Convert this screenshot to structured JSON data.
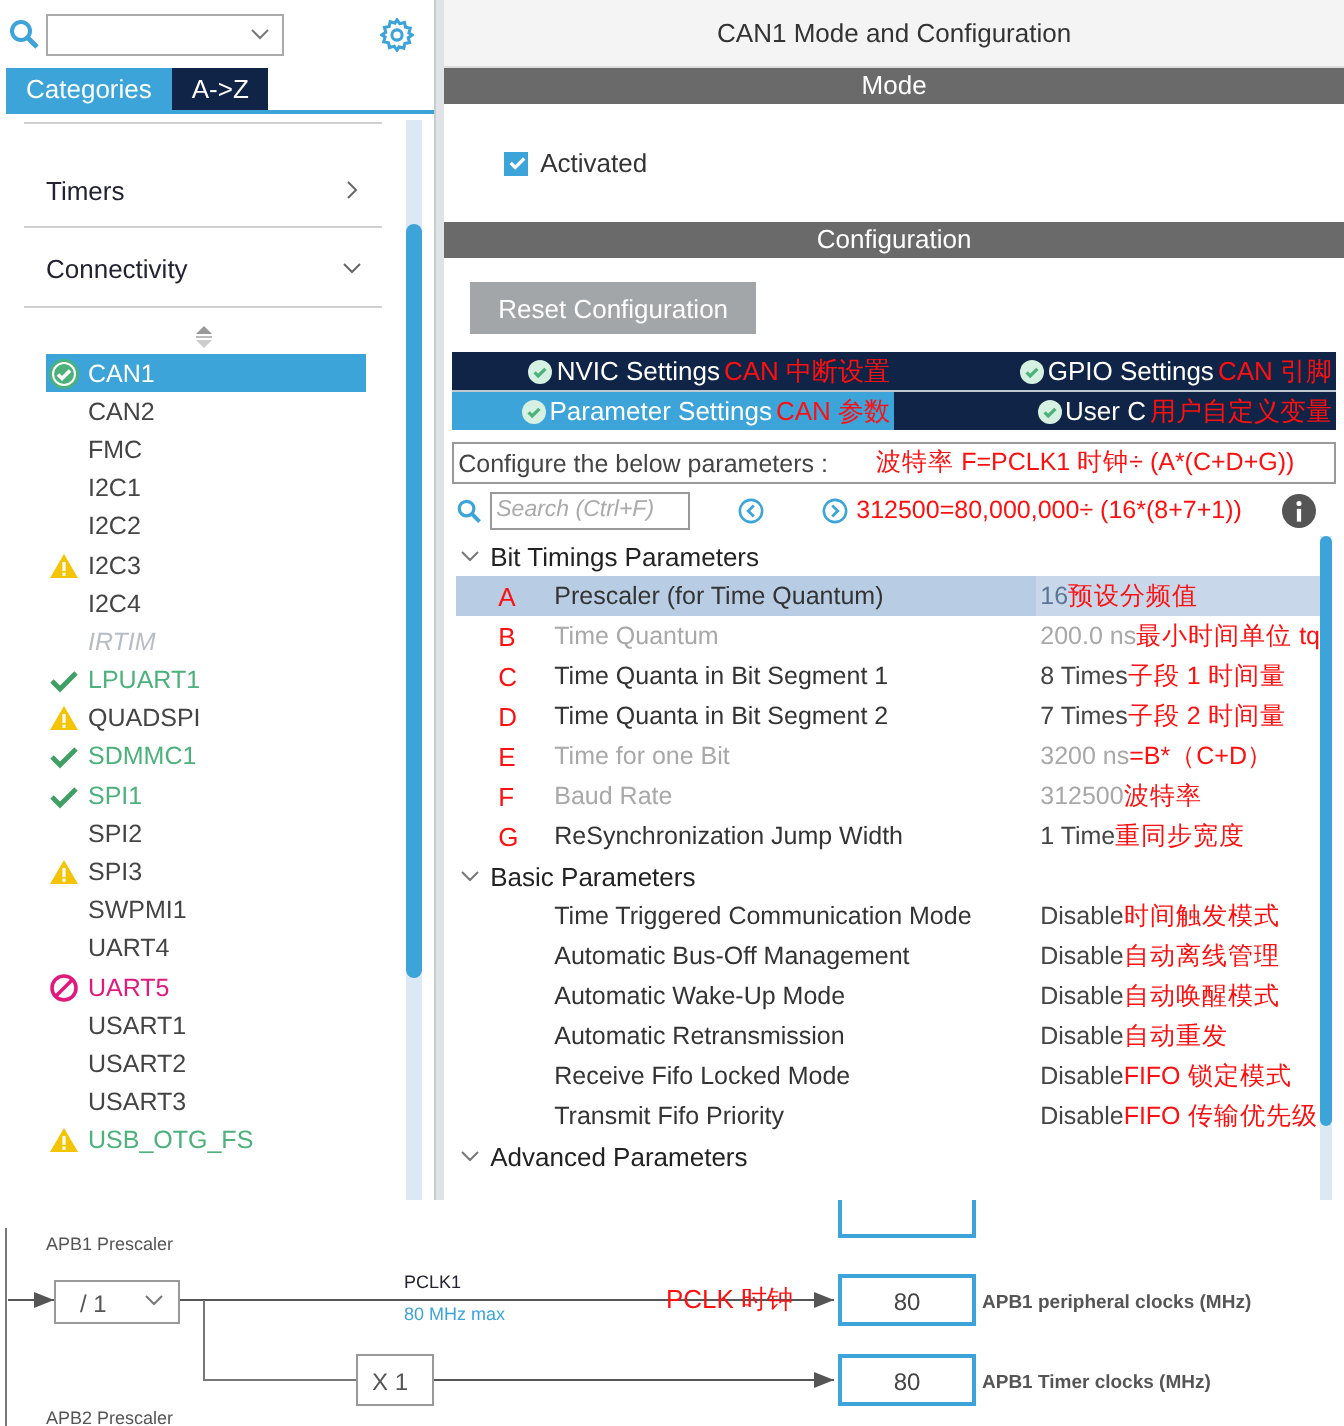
{
  "sidebar": {
    "tabs": [
      {
        "label": "Categories",
        "selected": true
      },
      {
        "label": "A->Z",
        "selected": false
      }
    ],
    "categories": [
      {
        "label": "Timers",
        "expanded": false
      },
      {
        "label": "Connectivity",
        "expanded": true,
        "children": [
          {
            "label": "CAN1",
            "kind": "active",
            "selected": true
          },
          {
            "label": "CAN2",
            "kind": "plain",
            "selected": false
          },
          {
            "label": "FMC",
            "kind": "plain",
            "selected": false
          },
          {
            "label": "I2C1",
            "kind": "plain",
            "selected": false
          },
          {
            "label": "I2C2",
            "kind": "plain",
            "selected": false
          },
          {
            "label": "I2C3",
            "kind": "warning",
            "selected": false
          },
          {
            "label": "I2C4",
            "kind": "plain",
            "selected": false
          },
          {
            "label": "IRTIM",
            "kind": "unavailable",
            "selected": false
          },
          {
            "label": "LPUART1",
            "kind": "configured",
            "selected": false
          },
          {
            "label": "QUADSPI",
            "kind": "warning",
            "selected": false
          },
          {
            "label": "SDMMC1",
            "kind": "configured",
            "selected": false
          },
          {
            "label": "SPI1",
            "kind": "configured",
            "selected": false
          },
          {
            "label": "SPI2",
            "kind": "plain",
            "selected": false
          },
          {
            "label": "SPI3",
            "kind": "warning",
            "selected": false
          },
          {
            "label": "SWPMI1",
            "kind": "plain",
            "selected": false
          },
          {
            "label": "UART4",
            "kind": "plain",
            "selected": false
          },
          {
            "label": "UART5",
            "kind": "conflict",
            "selected": false
          },
          {
            "label": "USART1",
            "kind": "plain",
            "selected": false
          },
          {
            "label": "USART2",
            "kind": "plain",
            "selected": false
          },
          {
            "label": "USART3",
            "kind": "plain",
            "selected": false
          },
          {
            "label": "USB_OTG_FS",
            "kind": "partial",
            "selected": false
          }
        ]
      }
    ]
  },
  "panel": {
    "title": "CAN1 Mode and Configuration",
    "mode": {
      "header": "Mode",
      "activated": {
        "label": "Activated",
        "checked": true
      }
    },
    "configuration": {
      "header": "Configuration",
      "reset_button": "Reset Configuration",
      "tabs": [
        {
          "label": "NVIC Settings",
          "note": "CAN 中断设置",
          "selected": false
        },
        {
          "label": "GPIO Settings",
          "note": "CAN 引脚",
          "selected": false
        },
        {
          "label": "Parameter Settings",
          "note": "CAN 参数",
          "selected": true
        },
        {
          "label": "User C",
          "note": "用户自定义变量",
          "selected": false
        }
      ],
      "hint": "Configure the below parameters :",
      "formula_notes": [
        "波特率 F=PCLK1 时钟÷ (A*(C+D+G))",
        "312500=80,000,000÷ (16*(8+7+1))"
      ],
      "search": {
        "placeholder": "Search (Ctrl+F)"
      },
      "groups": [
        {
          "label": "Bit Timings Parameters",
          "expanded": true,
          "children": [
            {
              "marker": "A",
              "name": "Prescaler (for Time Quantum)",
              "value": "16",
              "note": "预设分频值",
              "disabled": false,
              "selected": true
            },
            {
              "marker": "B",
              "name": "Time Quantum",
              "value": "200.0 ns",
              "note": "最小时间单位 tq",
              "disabled": true,
              "selected": false
            },
            {
              "marker": "C",
              "name": "Time Quanta in Bit Segment 1",
              "value": "8 Times",
              "note": "子段 1 时间量",
              "disabled": false,
              "selected": false
            },
            {
              "marker": "D",
              "name": "Time Quanta in Bit Segment 2",
              "value": "7 Times",
              "note": "子段 2 时间量",
              "disabled": false,
              "selected": false
            },
            {
              "marker": "E",
              "name": "Time for one Bit",
              "value": "3200 ns",
              "note": "=B*（C+D）",
              "disabled": true,
              "selected": false
            },
            {
              "marker": "F",
              "name": "Baud Rate",
              "value": "312500",
              "note": "波特率",
              "disabled": true,
              "selected": false
            },
            {
              "marker": "G",
              "name": "ReSynchronization Jump Width",
              "value": "1 Time",
              "note": "重同步宽度",
              "disabled": false,
              "selected": false
            }
          ]
        },
        {
          "label": "Basic Parameters",
          "expanded": true,
          "children": [
            {
              "name": "Time Triggered Communication Mode",
              "value": "Disable",
              "note": "时间触发模式",
              "disabled": false,
              "selected": false
            },
            {
              "name": "Automatic Bus-Off Management",
              "value": "Disable",
              "note": "自动离线管理",
              "disabled": false,
              "selected": false
            },
            {
              "name": "Automatic Wake-Up Mode",
              "value": "Disable",
              "note": "自动唤醒模式",
              "disabled": false,
              "selected": false
            },
            {
              "name": "Automatic Retransmission",
              "value": "Disable",
              "note": "自动重发",
              "disabled": false,
              "selected": false
            },
            {
              "name": "Receive Fifo Locked Mode",
              "value": "Disable",
              "note": "FIFO 锁定模式",
              "disabled": false,
              "selected": false
            },
            {
              "name": "Transmit Fifo Priority",
              "value": "Disable",
              "note": "FIFO 传输优先级",
              "disabled": false,
              "selected": false
            }
          ]
        },
        {
          "label": "Advanced Parameters",
          "expanded": true
        }
      ]
    }
  },
  "diagram": {
    "labels": [
      "APB1 Prescaler",
      "APB2 Prescaler"
    ],
    "prescaler": "/ 1",
    "signal": {
      "name": "PCLK1",
      "limit": "80 MHz max",
      "note": "PCLK 时钟"
    },
    "multiplier": "X 1",
    "outputs": [
      {
        "value": "80",
        "label": "APB1 peripheral clocks (MHz)"
      },
      {
        "value": "80",
        "label": "APB1 Timer clocks (MHz)"
      }
    ]
  }
}
